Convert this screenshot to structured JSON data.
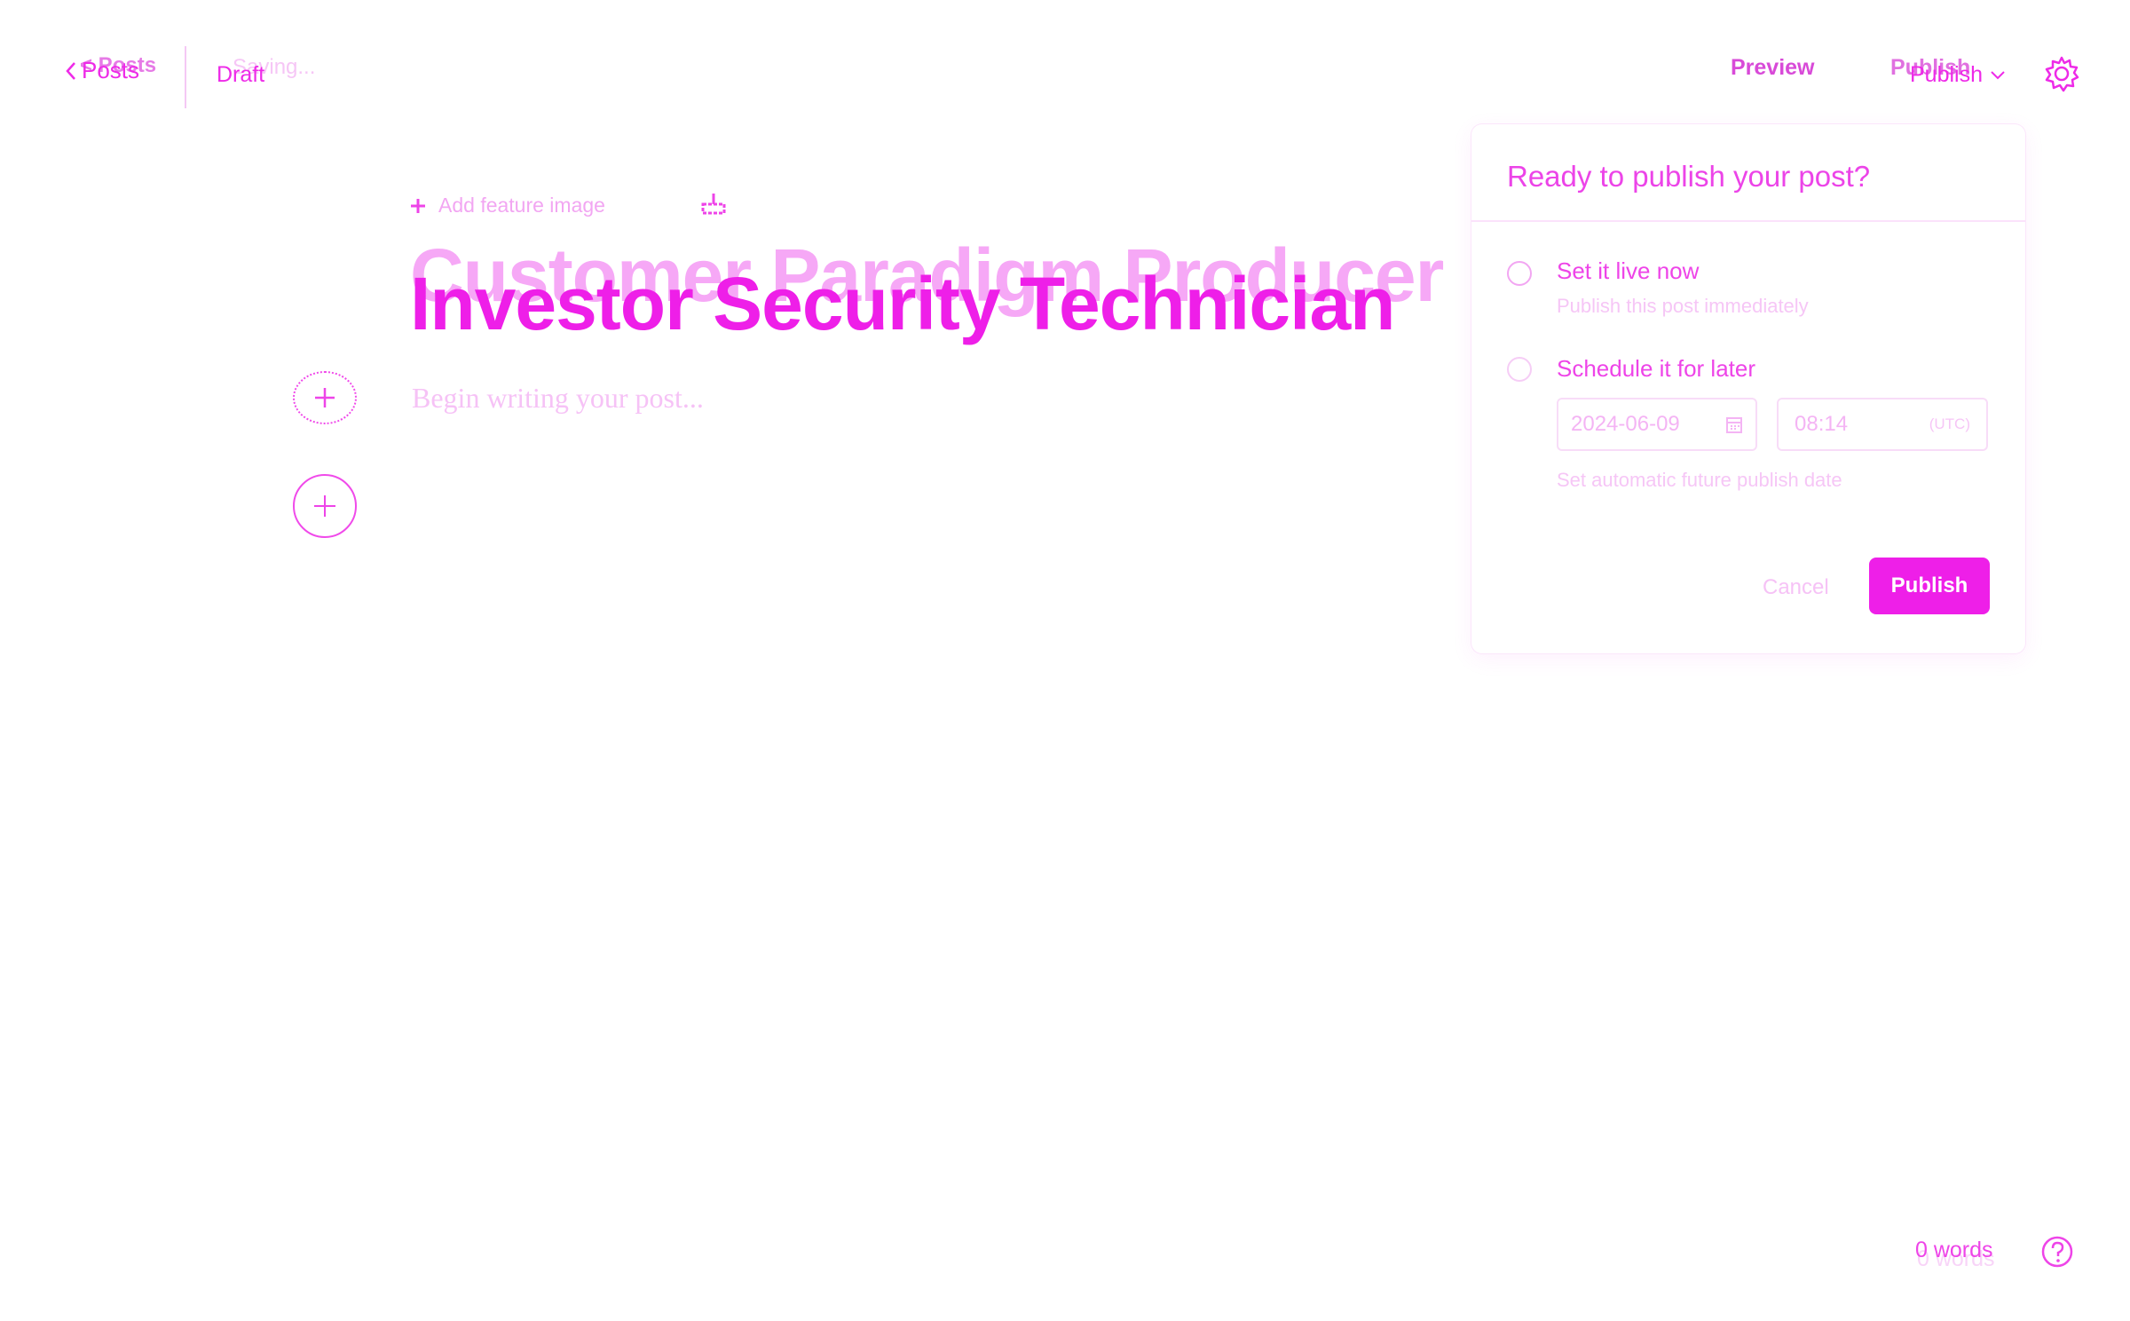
{
  "colors": {
    "accent": "#ee1fe8",
    "accent_light": "#f6c2f6",
    "background": "#ffffff"
  },
  "header": {
    "back_label": "Posts",
    "back_ghost_label": "< Posts",
    "status": "Draft",
    "status_ghost": "Saving...",
    "preview_label": "Preview",
    "publish_label": "Publish",
    "publish_ghost_label": "Publish",
    "settings_icon": "gear-icon"
  },
  "editor": {
    "feature_image_label": "Add feature image",
    "title_ghost": "Customer Paradigm Producer",
    "title": "Investor Security Technician",
    "body_placeholder": "Begin writing your post..."
  },
  "publish_panel": {
    "title": "Ready to publish your post?",
    "option_now_label": "Set it live now",
    "option_now_sub": "Publish this post immediately",
    "option_later_label": "Schedule it for later",
    "date_value": "2024-06-09",
    "time_value": "08:14",
    "timezone": "(UTC)",
    "schedule_hint": "Set automatic future publish date",
    "cancel_label": "Cancel",
    "publish_label": "Publish"
  },
  "footer": {
    "word_count": "0 words",
    "word_count_ghost": "0 words",
    "help_icon": "help-icon"
  }
}
